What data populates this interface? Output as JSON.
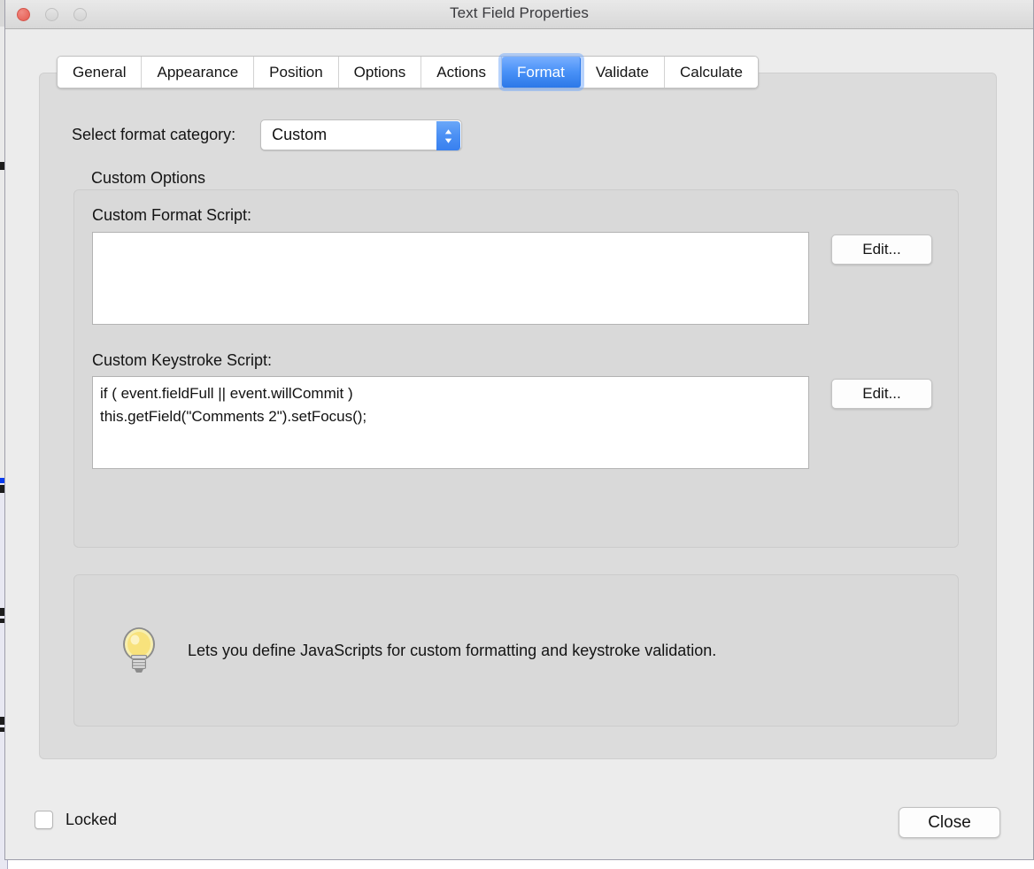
{
  "window": {
    "title": "Text Field Properties",
    "traffic_lights": [
      {
        "name": "close",
        "color": "#e8685e",
        "enabled": true
      },
      {
        "name": "minimize",
        "color": "#d8d8d8",
        "enabled": false
      },
      {
        "name": "maximize",
        "color": "#d8d8d8",
        "enabled": false
      }
    ]
  },
  "tabs": [
    {
      "label": "General",
      "selected": false
    },
    {
      "label": "Appearance",
      "selected": false
    },
    {
      "label": "Position",
      "selected": false
    },
    {
      "label": "Options",
      "selected": false
    },
    {
      "label": "Actions",
      "selected": false
    },
    {
      "label": "Format",
      "selected": true
    },
    {
      "label": "Validate",
      "selected": false
    },
    {
      "label": "Calculate",
      "selected": false
    }
  ],
  "format": {
    "category_label": "Select format category:",
    "category_value": "Custom",
    "group_title": "Custom Options",
    "format_script_label": "Custom Format Script:",
    "format_script_value": "",
    "format_script_edit_label": "Edit...",
    "keystroke_script_label": "Custom Keystroke Script:",
    "keystroke_script_value": "if ( event.fieldFull || event.willCommit )\nthis.getField(\"Comments 2\").setFocus();",
    "keystroke_script_edit_label": "Edit..."
  },
  "hint": {
    "icon": "lightbulb-icon",
    "text": "Lets you define JavaScripts for custom formatting and keystroke validation."
  },
  "footer": {
    "locked_label": "Locked",
    "locked_checked": false,
    "close_label": "Close"
  },
  "colors": {
    "accent_blue": "#2c78e8",
    "accent_blue_light": "#79afff",
    "focus_ring": "#7dabfa",
    "window_bg": "#ececec",
    "panel_bg": "#dcdcdc",
    "group_bg": "#d9d9d9",
    "close_button_red": "#e8685e",
    "bulb_yellow": "#f5e27a"
  }
}
